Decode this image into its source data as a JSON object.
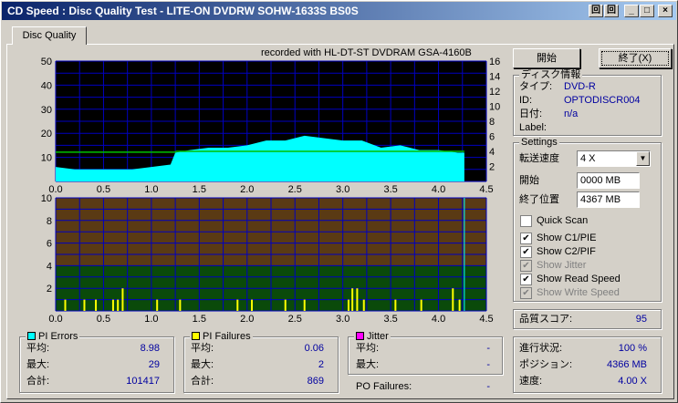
{
  "window": {
    "title": "CD Speed : Disc Quality Test - LITE-ON DVDRW SOHW-1633S BS0S",
    "btn_a": "回",
    "btn_b": "回",
    "btn_min": "_",
    "btn_max": "□",
    "btn_close": "×"
  },
  "tab": {
    "label": "Disc Quality"
  },
  "recorded_with": "recorded with HL-DT-ST DVDRAM GSA-4160B",
  "buttons": {
    "start": "開始",
    "stop": "終了(X)"
  },
  "disc_info": {
    "title": "ディスク情報",
    "type_label": "タイプ:",
    "type_value": "DVD-R",
    "id_label": "ID:",
    "id_value": "OPTODISCR004",
    "date_label": "日付:",
    "date_value": "n/a",
    "label_label": "Label:",
    "label_value": ""
  },
  "settings": {
    "title": "Settings",
    "speed_label": "転送速度",
    "speed_value": "4 X",
    "start_label": "開始",
    "start_value": "0000 MB",
    "end_label": "終了位置",
    "end_value": "4367 MB",
    "quick_scan": "Quick Scan",
    "show_c1": "Show C1/PIE",
    "show_c2": "Show C2/PIF",
    "show_jitter": "Show Jitter",
    "show_read": "Show Read Speed",
    "show_write": "Show Write Speed"
  },
  "quality": {
    "label": "品質スコア:",
    "value": "95"
  },
  "progress": {
    "progress_label": "進行状況:",
    "progress_value": "100 %",
    "position_label": "ポジション:",
    "position_value": "4366 MB",
    "speed_label": "速度:",
    "speed_value": "4.00 X"
  },
  "pi_errors": {
    "title": "PI Errors",
    "avg_label": "平均:",
    "avg": "8.98",
    "max_label": "最大:",
    "max": "29",
    "total_label": "合計:",
    "total": "101417"
  },
  "pi_failures": {
    "title": "PI Failures",
    "avg_label": "平均:",
    "avg": "0.06",
    "max_label": "最大:",
    "max": "2",
    "total_label": "合計:",
    "total": "869"
  },
  "jitter": {
    "title": "Jitter",
    "avg_label": "平均:",
    "avg": "-",
    "max_label": "最大:",
    "max": "-"
  },
  "po_failures": {
    "label": "PO Failures:",
    "value": "-"
  },
  "colors": {
    "pie": "#00ffff",
    "pif": "#ffff00",
    "jitter": "#ff00ff",
    "speed": "#00c000",
    "upper_bg": "#000000",
    "grid": "#0000c0",
    "lower_top": "#5a3a14",
    "lower_bottom": "#0a4a0a"
  },
  "chart_data": [
    {
      "type": "area",
      "name": "PI Errors",
      "x_ticks": [
        "0.0",
        "0.5",
        "1.0",
        "1.5",
        "2.0",
        "2.5",
        "3.0",
        "3.5",
        "4.0",
        "4.5"
      ],
      "y_left_ticks": [
        "50",
        "40",
        "30",
        "20",
        "10"
      ],
      "y_right_ticks": [
        "16",
        "14",
        "12",
        "10",
        "8",
        "6",
        "4",
        "2"
      ],
      "xlim": [
        0,
        4.5
      ],
      "ylim": [
        0,
        50
      ],
      "y2lim": [
        0,
        16
      ],
      "x_gb": [
        0.0,
        0.2,
        0.4,
        0.6,
        0.8,
        1.0,
        1.2,
        1.25,
        1.4,
        1.6,
        1.8,
        2.0,
        2.2,
        2.4,
        2.6,
        2.8,
        3.0,
        3.2,
        3.4,
        3.6,
        3.8,
        4.0,
        4.2,
        4.27
      ],
      "pie": [
        6,
        5,
        5,
        5,
        5,
        6,
        7,
        12,
        13,
        14,
        14,
        15,
        17,
        17,
        19,
        18,
        17,
        17,
        14,
        15,
        13,
        13,
        12,
        12
      ],
      "read_speed_x": [
        0.0,
        1.25,
        1.26,
        4.27
      ],
      "read_speed": [
        3.9,
        3.9,
        4.0,
        4.0
      ]
    },
    {
      "type": "bar",
      "name": "PI Failures",
      "x_ticks": [
        "0.0",
        "0.5",
        "1.0",
        "1.5",
        "2.0",
        "2.5",
        "3.0",
        "3.5",
        "4.0",
        "4.5"
      ],
      "y_ticks": [
        "10",
        "8",
        "6",
        "4",
        "2"
      ],
      "xlim": [
        0,
        4.5
      ],
      "ylim": [
        0,
        10
      ],
      "x_gb": [
        0.1,
        0.3,
        0.42,
        0.6,
        0.65,
        0.7,
        1.06,
        1.3,
        1.9,
        2.05,
        2.4,
        2.6,
        3.06,
        3.1,
        3.15,
        3.22,
        3.55,
        3.82,
        4.15,
        4.22
      ],
      "pif": [
        1,
        1,
        1,
        1,
        1,
        2,
        1,
        1,
        1,
        1,
        1,
        1,
        1,
        2,
        2,
        1,
        1,
        1,
        2,
        1
      ]
    }
  ]
}
